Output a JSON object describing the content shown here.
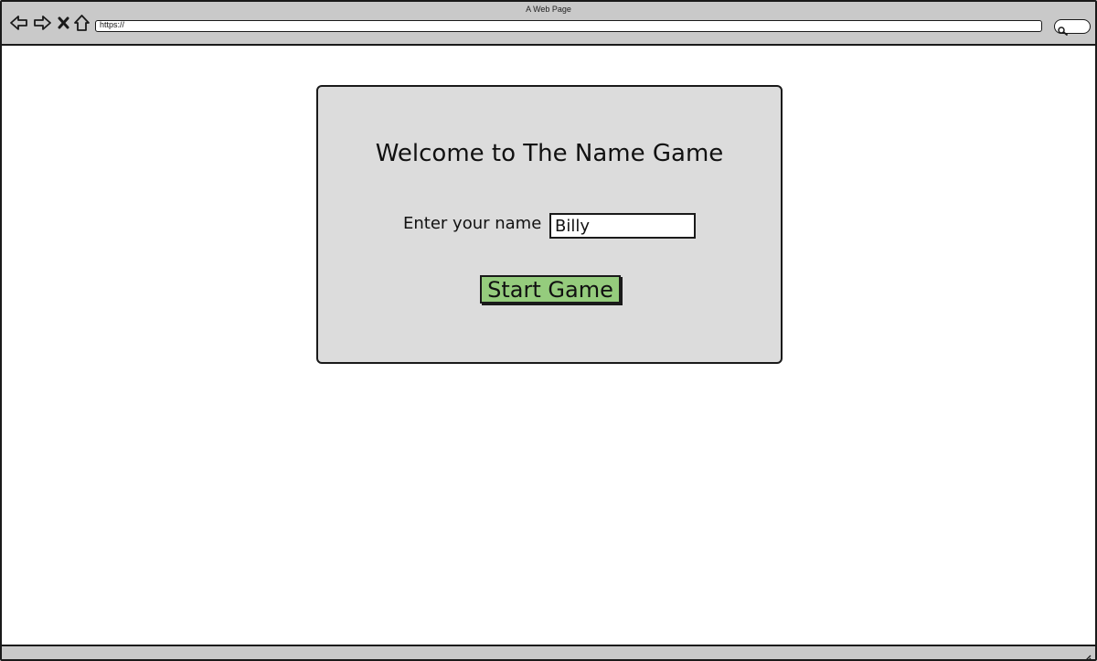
{
  "window": {
    "title": "A Web Page",
    "url": "https://"
  },
  "toolbar": {
    "back_icon": "arrow-left-icon",
    "forward_icon": "arrow-right-icon",
    "stop_icon": "close-icon",
    "home_icon": "home-icon",
    "search_icon": "search-icon"
  },
  "form": {
    "title": "Welcome to The Name Game",
    "name_label": "Enter your name",
    "name_value": "Billy",
    "start_label": "Start Game"
  },
  "colors": {
    "panel_bg": "#dcdcdc",
    "button_bg": "#95cc7d",
    "chrome_bg": "#c9c9c9"
  }
}
